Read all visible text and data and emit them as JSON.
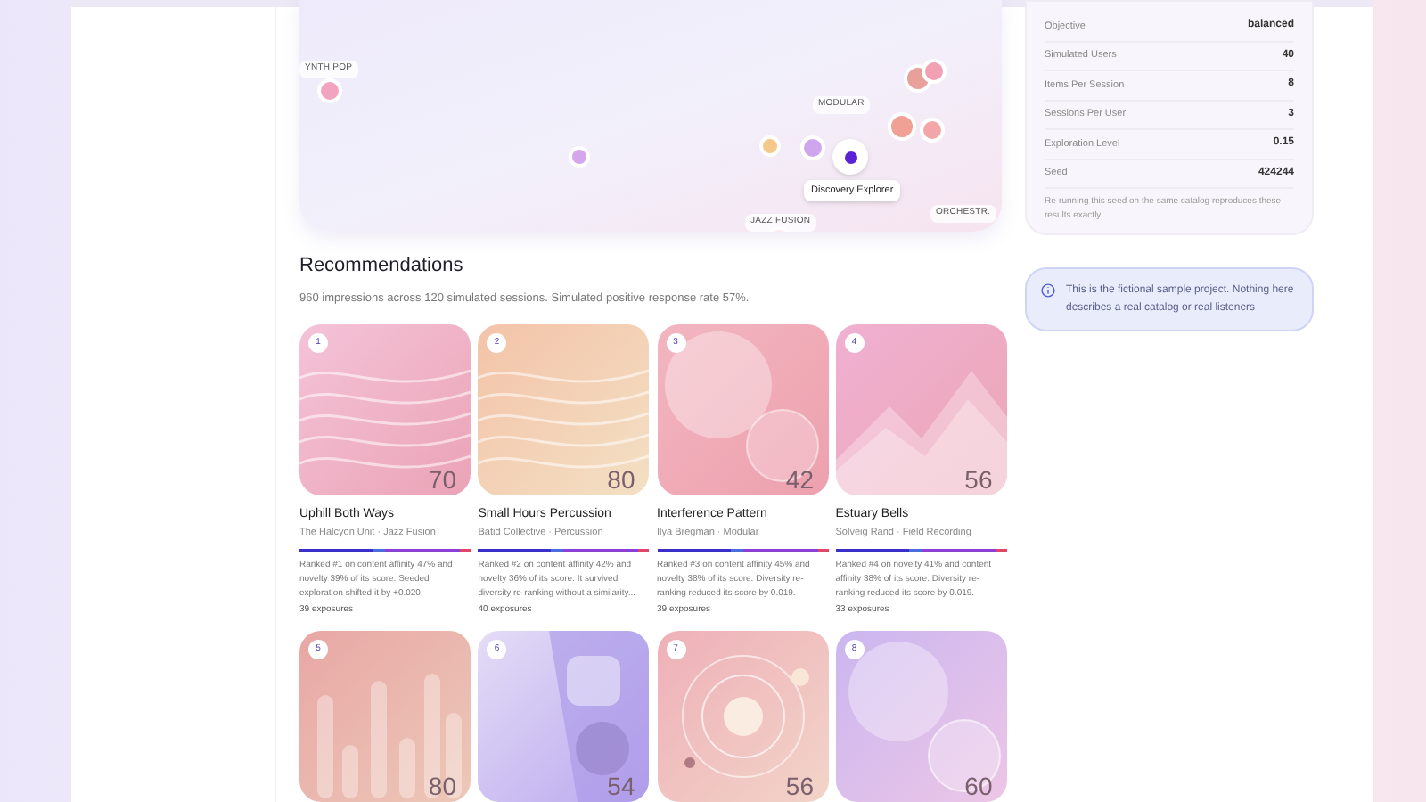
{
  "map": {
    "clusters": [
      {
        "label": "YNTH POP"
      },
      {
        "label": "MODULAR"
      },
      {
        "label": "JAZZ FUSION"
      },
      {
        "label": "ORCHESTR."
      }
    ],
    "focus_label": "Discovery Explorer"
  },
  "recommendations": {
    "title": "Recommendations",
    "summary": "960 impressions across 120 simulated sessions. Simulated positive response rate 57%.",
    "items": [
      {
        "rank": "1",
        "kind": "waves",
        "art_number": "70",
        "title": "Uphill Both Ways",
        "subtitle": "The Halcyon Unit · Jazz Fusion",
        "description": "Ranked #1 on content affinity 47% and novelty 39% of its score. Seeded exploration shifted it by +0.020.",
        "exposures": "39 exposures"
      },
      {
        "rank": "2",
        "kind": "waves",
        "art_number": "80",
        "title": "Small Hours Percussion",
        "subtitle": "Batid Collective · Percussion",
        "description": "Ranked #2 on content affinity 42% and novelty 36% of its score. It survived diversity re-ranking without a similarity...",
        "exposures": "40 exposures"
      },
      {
        "rank": "3",
        "kind": "circles",
        "art_number": "42",
        "title": "Interference Pattern",
        "subtitle": "Ilya Bregman · Modular",
        "description": "Ranked #3 on content affinity 45% and novelty 38% of its score. Diversity re-ranking reduced its score by 0.019.",
        "exposures": "39 exposures"
      },
      {
        "rank": "4",
        "kind": "mountains",
        "art_number": "56",
        "title": "Estuary Bells",
        "subtitle": "Solveig Rand · Field Recording",
        "description": "Ranked #4 on novelty 41% and content affinity 38% of its score. Diversity re-ranking reduced its score by 0.019.",
        "exposures": "33 exposures"
      },
      {
        "rank": "5",
        "kind": "bars",
        "art_number": "80"
      },
      {
        "rank": "6",
        "kind": "squares",
        "art_number": "54"
      },
      {
        "rank": "7",
        "kind": "orbit",
        "art_number": "56"
      },
      {
        "rank": "8",
        "kind": "spheres",
        "art_number": "60"
      }
    ]
  },
  "settings": {
    "rows": [
      {
        "label": "Objective",
        "value": "balanced"
      },
      {
        "label": "Simulated Users",
        "value": "40"
      },
      {
        "label": "Items Per Session",
        "value": "8"
      },
      {
        "label": "Sessions Per User",
        "value": "3"
      },
      {
        "label": "Exploration Level",
        "value": "0.15"
      },
      {
        "label": "Seed",
        "value": "424244"
      }
    ],
    "note": "Re-running this seed on the same catalog reproduces these results exactly"
  },
  "notice": "This is the fictional sample project. Nothing here describes a real catalog or real listeners"
}
